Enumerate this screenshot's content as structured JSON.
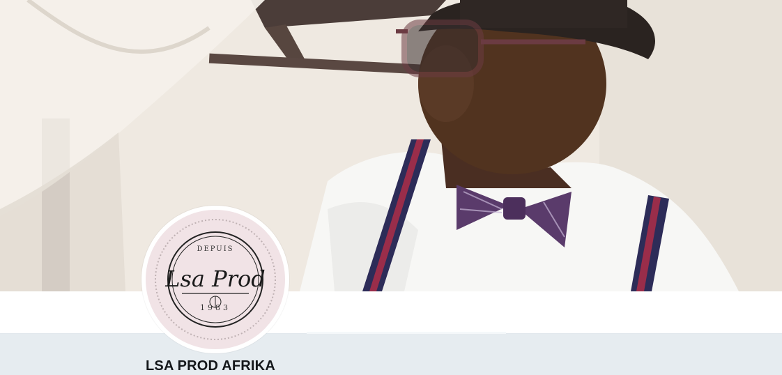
{
  "header": {
    "banner_alt": "",
    "colors": {
      "banner_base": "#ece6de",
      "background": "#e6ecf0",
      "navbar": "#ffffff"
    }
  },
  "profile": {
    "name": "LSA PROD AFRIKA",
    "avatar": {
      "logo_top": "DEPUIS",
      "logo_main": "Lsa Prod",
      "logo_bottom": "1983",
      "background_color": "#f1e3e6"
    }
  }
}
